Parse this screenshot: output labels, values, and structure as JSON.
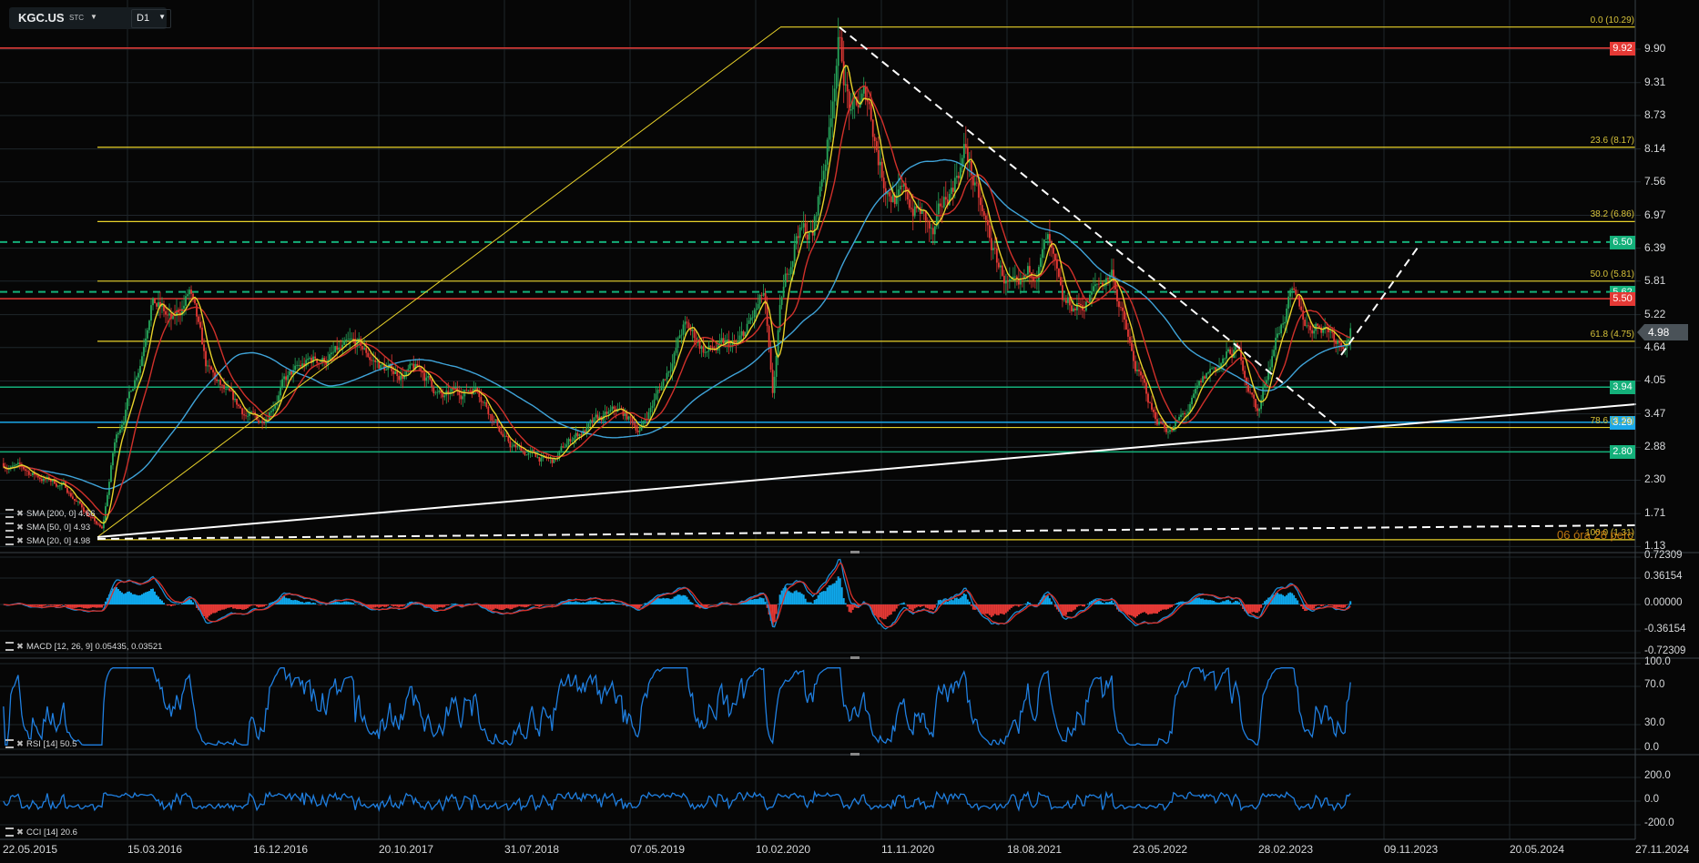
{
  "header": {
    "symbol": "KGC.US",
    "exchange": "STC",
    "timeframe": "D1"
  },
  "colors": {
    "bg": "#060606",
    "grid": "#1f262b",
    "up": "#26a65b",
    "down": "#e53935",
    "sma20": "#e8d22a",
    "sma50": "#d0302a",
    "sma200": "#3fa3d8",
    "fib": "#e8d22a",
    "macd_pos": "#0fa8ec",
    "macd_neg": "#e53935",
    "osc": "#1f7fe0"
  },
  "price_axis": {
    "ticks": [
      "9.90",
      "9.31",
      "8.73",
      "8.14",
      "7.56",
      "6.97",
      "6.39",
      "5.81",
      "5.22",
      "4.64",
      "4.05",
      "3.47",
      "2.88",
      "2.30",
      "1.71",
      "1.13"
    ],
    "current": "4.98"
  },
  "levels": [
    {
      "price": 9.92,
      "label": "9.92",
      "color": "#e53935",
      "style": "solid"
    },
    {
      "price": 6.5,
      "label": "6.50",
      "color": "#14b07a",
      "style": "dashed"
    },
    {
      "price": 5.62,
      "label": "5.62",
      "color": "#14b07a",
      "style": "dashed"
    },
    {
      "price": 5.5,
      "label": "5.50",
      "color": "#e53935",
      "style": "solid"
    },
    {
      "price": 3.94,
      "label": "3.94",
      "color": "#14b07a",
      "style": "solid"
    },
    {
      "price": 3.32,
      "label": "3.29",
      "color": "#1aa7e8",
      "style": "solid"
    },
    {
      "price": 2.8,
      "label": "2.80",
      "color": "#14b07a",
      "style": "solid"
    }
  ],
  "fibonacci": [
    {
      "price": 10.29,
      "label": "0.0 (10.29)"
    },
    {
      "price": 8.17,
      "label": "23.6 (8.17)"
    },
    {
      "price": 6.86,
      "label": "38.2 (6.86)"
    },
    {
      "price": 5.81,
      "label": "50.0 (5.81)"
    },
    {
      "price": 4.75,
      "label": "61.8 (4.75)"
    },
    {
      "price": 3.23,
      "label": "78.6 (3.23)"
    },
    {
      "price": 1.25,
      "label": "100.0 (1.31)"
    }
  ],
  "timer": "06 óra 28 perc",
  "legends": {
    "sma200": "SMA [200, 0] 4.66",
    "sma50": "SMA [50, 0] 4.93",
    "sma20": "SMA [20, 0] 4.98",
    "macd": "MACD [12, 26, 9] 0.05435,  0.03521",
    "rsi": "RSI [14] 50.5",
    "cci": "CCI [14] 20.6"
  },
  "macd_axis": [
    "0.72309",
    "0.36154",
    "0.00000",
    "-0.36154",
    "-0.72309"
  ],
  "rsi_axis": [
    "100.0",
    "70.0",
    "30.0",
    "0.0"
  ],
  "cci_axis": [
    "200.0",
    "0.0",
    "-200.0"
  ],
  "dates": [
    "22.05.2015",
    "15.03.2016",
    "16.12.2016",
    "20.10.2017",
    "31.07.2018",
    "07.05.2019",
    "10.02.2020",
    "11.11.2020",
    "18.08.2021",
    "23.05.2022",
    "28.02.2023",
    "09.11.2023",
    "20.05.2024",
    "27.11.2024"
  ],
  "chart_data": {
    "type": "candlestick",
    "title": "KGC.US D1",
    "price_keypoints": [
      [
        2015.46,
        2.6
      ],
      [
        2015.82,
        2.2
      ],
      [
        2016.05,
        1.4
      ],
      [
        2016.12,
        2.9
      ],
      [
        2016.28,
        4.5
      ],
      [
        2016.34,
        5.6
      ],
      [
        2016.47,
        5.0
      ],
      [
        2016.57,
        5.6
      ],
      [
        2016.67,
        4.2
      ],
      [
        2016.83,
        3.6
      ],
      [
        2016.99,
        3.3
      ],
      [
        2017.12,
        4.0
      ],
      [
        2017.31,
        4.4
      ],
      [
        2017.57,
        4.6
      ],
      [
        2017.77,
        4.2
      ],
      [
        2017.96,
        4.2
      ],
      [
        2018.09,
        3.7
      ],
      [
        2018.29,
        4.0
      ],
      [
        2018.48,
        2.9
      ],
      [
        2018.74,
        2.6
      ],
      [
        2018.87,
        3.1
      ],
      [
        2019.13,
        3.5
      ],
      [
        2019.26,
        3.2
      ],
      [
        2019.39,
        4.0
      ],
      [
        2019.52,
        5.0
      ],
      [
        2019.65,
        4.6
      ],
      [
        2019.84,
        4.6
      ],
      [
        2020.0,
        5.5
      ],
      [
        2020.05,
        3.6
      ],
      [
        2020.1,
        5.3
      ],
      [
        2020.2,
        6.8
      ],
      [
        2020.29,
        6.6
      ],
      [
        2020.39,
        8.5
      ],
      [
        2020.44,
        10.2
      ],
      [
        2020.52,
        8.7
      ],
      [
        2020.62,
        9.0
      ],
      [
        2020.71,
        7.7
      ],
      [
        2020.81,
        7.3
      ],
      [
        2020.94,
        7.0
      ],
      [
        2021.01,
        6.5
      ],
      [
        2021.1,
        7.3
      ],
      [
        2021.2,
        8.2
      ],
      [
        2021.3,
        6.9
      ],
      [
        2021.39,
        6.1
      ],
      [
        2021.52,
        5.4
      ],
      [
        2021.69,
        6.5
      ],
      [
        2021.78,
        5.2
      ],
      [
        2021.91,
        5.4
      ],
      [
        2022.08,
        6.0
      ],
      [
        2022.2,
        4.4
      ],
      [
        2022.33,
        3.4
      ],
      [
        2022.43,
        3.2
      ],
      [
        2022.53,
        3.5
      ],
      [
        2022.66,
        4.2
      ],
      [
        2022.82,
        4.6
      ],
      [
        2022.95,
        3.5
      ],
      [
        2023.05,
        4.8
      ],
      [
        2023.14,
        5.5
      ],
      [
        2023.24,
        5.0
      ],
      [
        2023.34,
        5.1
      ],
      [
        2023.44,
        4.8
      ],
      [
        2023.5,
        4.98
      ]
    ]
  }
}
